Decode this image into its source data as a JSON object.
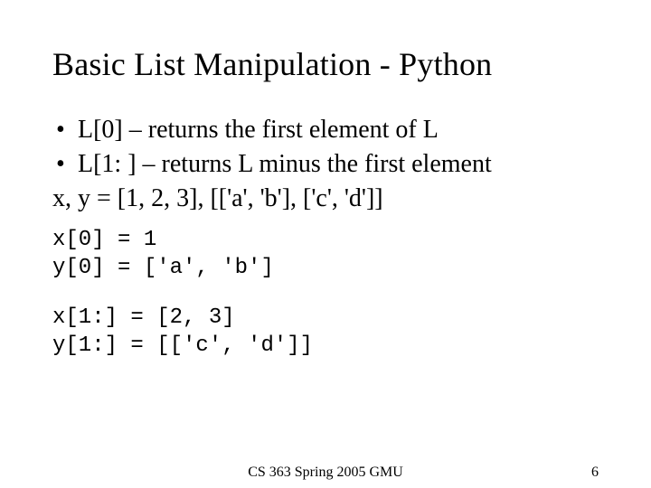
{
  "title": "Basic List Manipulation - Python",
  "bullets": [
    "L[0] – returns the first element of L",
    "L[1: ] – returns L minus the first element"
  ],
  "assignment_line": "x, y = [1, 2, 3], [['a', 'b'], ['c', 'd']]",
  "code_blocks": [
    "x[0] = 1\ny[0] = ['a', 'b']",
    "x[1:] = [2, 3]\ny[1:] = [['c', 'd']]"
  ],
  "footer": {
    "center": "CS 363 Spring 2005 GMU",
    "page": "6"
  }
}
